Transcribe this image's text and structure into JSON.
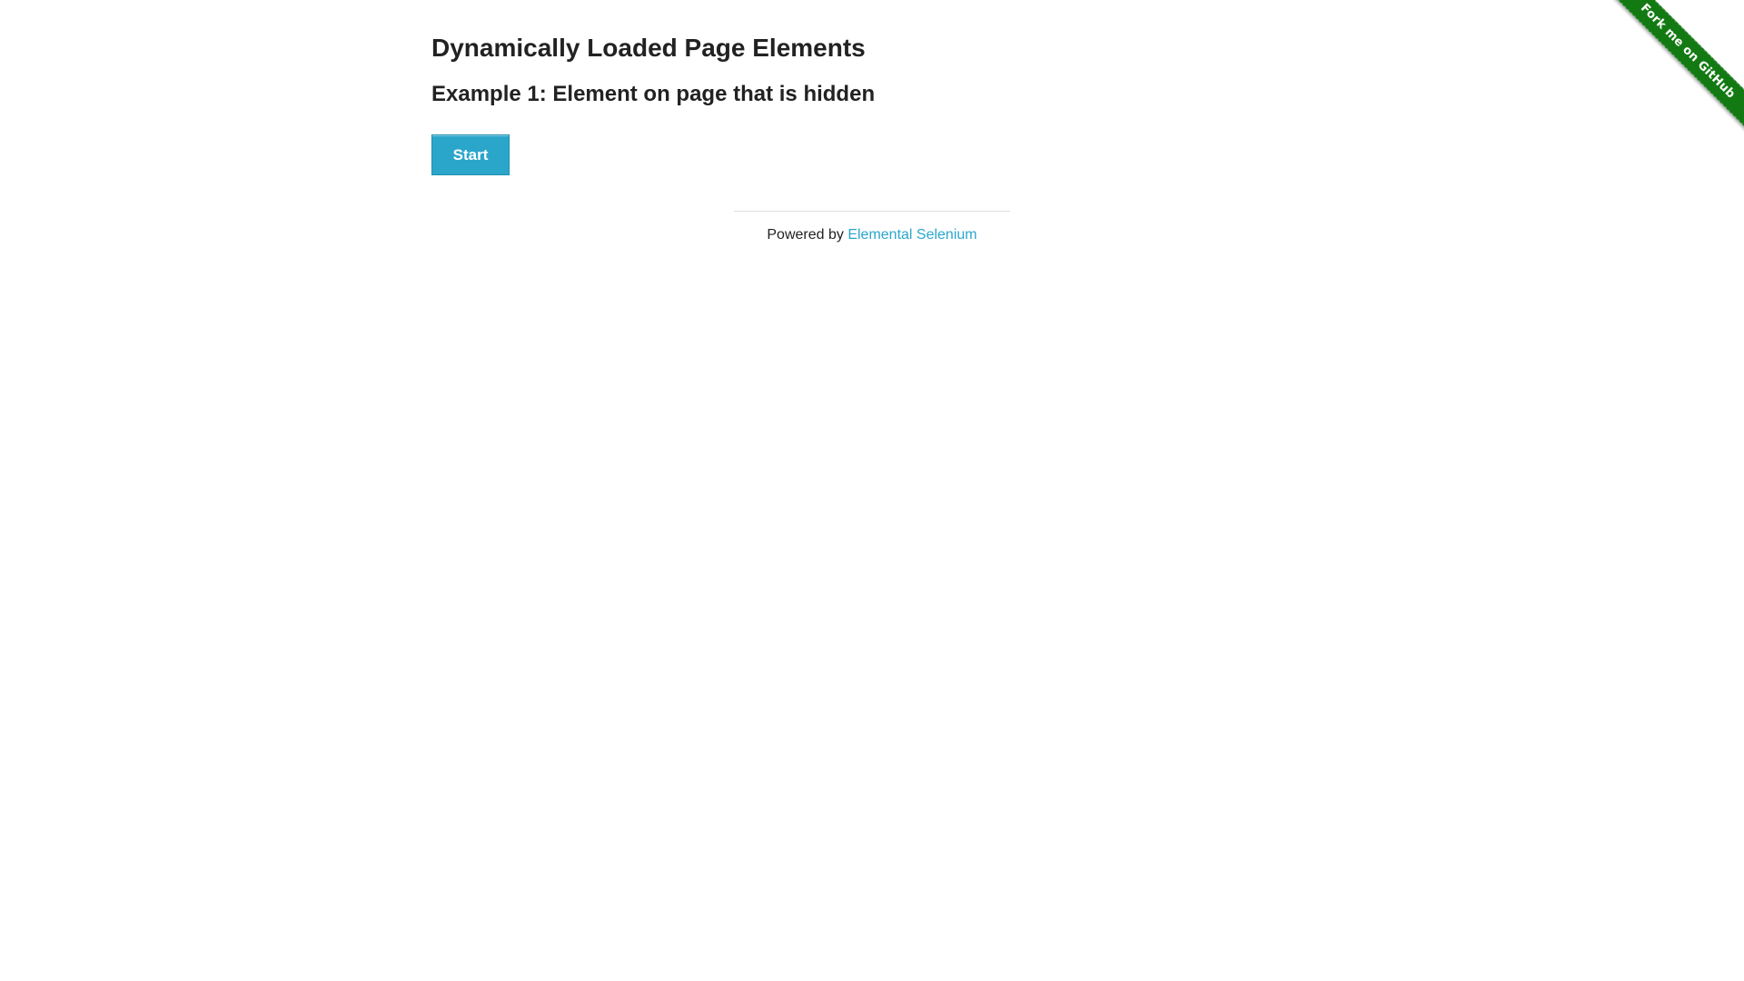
{
  "ribbon": {
    "label": "Fork me on GitHub",
    "color": "#137a13"
  },
  "main": {
    "title": "Dynamically Loaded Page Elements",
    "subtitle": "Example 1: Element on page that is hidden",
    "start_label": "Start"
  },
  "footer": {
    "prefix": "Powered by ",
    "link_label": "Elemental Selenium"
  },
  "colors": {
    "accent": "#2ba6cb",
    "text": "#222222",
    "divider": "#dddddd"
  }
}
